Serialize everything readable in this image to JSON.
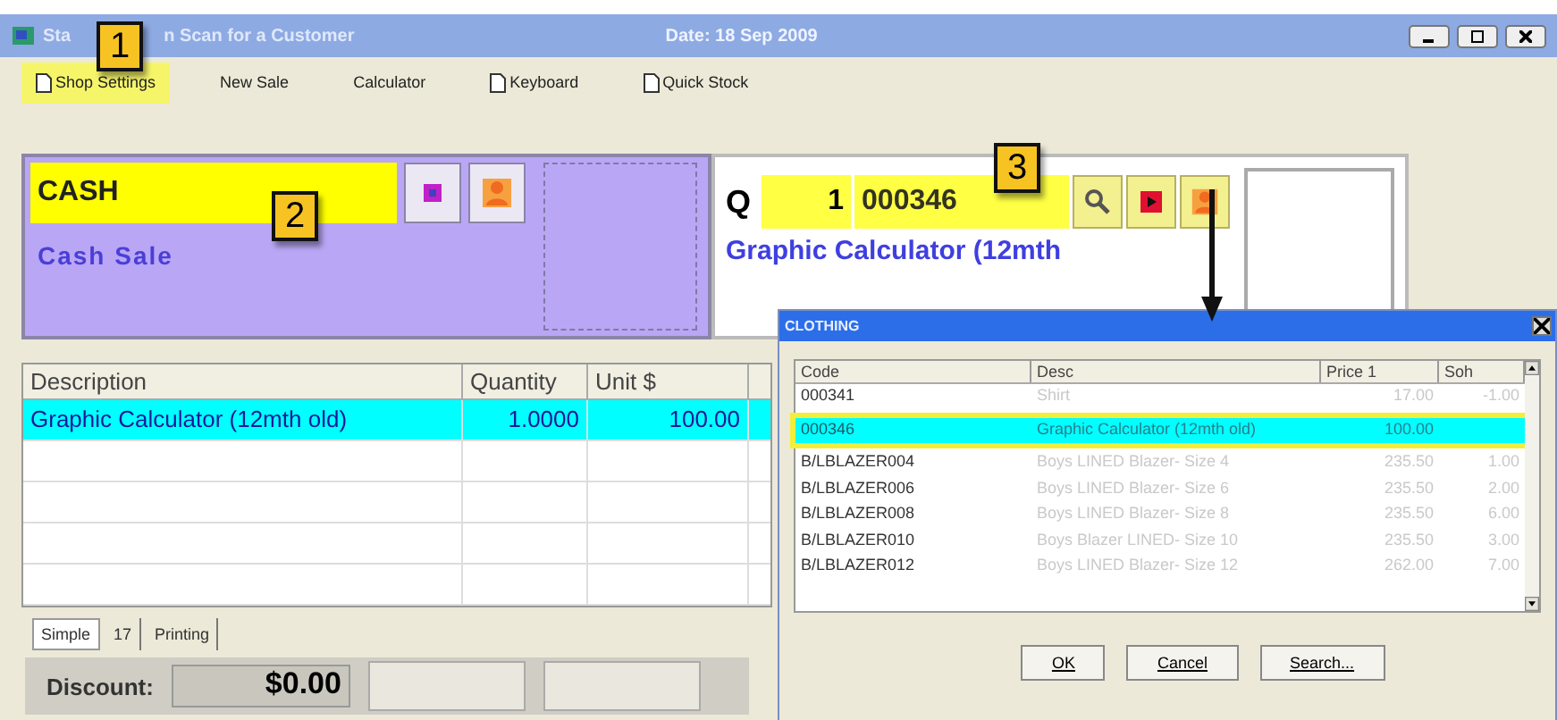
{
  "window": {
    "title_parts": [
      "Sta",
      "n Scan for a Customer"
    ],
    "date": "Date: 18 Sep 2009"
  },
  "callouts": [
    "1",
    "2",
    "3"
  ],
  "toolbar": [
    {
      "label": "Shop Settings",
      "kind": "doc",
      "highlighted": true
    },
    {
      "label": "New Sale",
      "kind": "plain",
      "highlighted": false
    },
    {
      "label": "Calculator",
      "kind": "plain",
      "highlighted": false
    },
    {
      "label": "Keyboard",
      "kind": "doc",
      "highlighted": false
    },
    {
      "label": "Quick Stock",
      "kind": "doc",
      "highlighted": false
    }
  ],
  "customer": {
    "code": "CASH",
    "name": "Cash Sale"
  },
  "entry": {
    "q_label": "Q",
    "quantity": "1",
    "code": "000346",
    "description": "Graphic Calculator (12mth"
  },
  "sale_table": {
    "columns": [
      "Description",
      "Quantity",
      "Unit $"
    ],
    "rows": [
      {
        "cells": [
          "Graphic Calculator (12mth old)",
          "1.0000",
          "100.00"
        ],
        "selected": true
      }
    ]
  },
  "tabs": [
    {
      "label": "Simple",
      "selected": true
    },
    {
      "label": "17",
      "selected": false
    },
    {
      "label": "Printing",
      "selected": false
    }
  ],
  "discount": {
    "label": "Discount:",
    "value": "$0.00"
  },
  "dialog": {
    "title": "CLOTHING",
    "columns": [
      "Code",
      "Desc",
      "Price 1",
      "Soh"
    ],
    "rows": [
      {
        "cells": [
          "000341",
          "Shirt",
          "17.00",
          "-1.00"
        ],
        "selected": false
      },
      {
        "cells": [
          "000346",
          "Graphic Calculator (12mth old)",
          "100.00",
          ""
        ],
        "selected": true
      },
      {
        "cells": [
          "B/LBLAZER004",
          "Boys LINED Blazer- Size 4",
          "235.50",
          "1.00"
        ],
        "selected": false
      },
      {
        "cells": [
          "B/LBLAZER006",
          "Boys LINED Blazer- Size 6",
          "235.50",
          "2.00"
        ],
        "selected": false
      },
      {
        "cells": [
          "B/LBLAZER008",
          "Boys LINED Blazer- Size 8",
          "235.50",
          "6.00"
        ],
        "selected": false
      },
      {
        "cells": [
          "B/LBLAZER010",
          "Boys Blazer LINED- Size 10",
          "235.50",
          "3.00"
        ],
        "selected": false
      },
      {
        "cells": [
          "B/LBLAZER012",
          "Boys LINED Blazer- Size 12",
          "262.00",
          "7.00"
        ],
        "selected": false
      }
    ],
    "buttons": [
      "OK",
      "Cancel",
      "Search..."
    ]
  }
}
